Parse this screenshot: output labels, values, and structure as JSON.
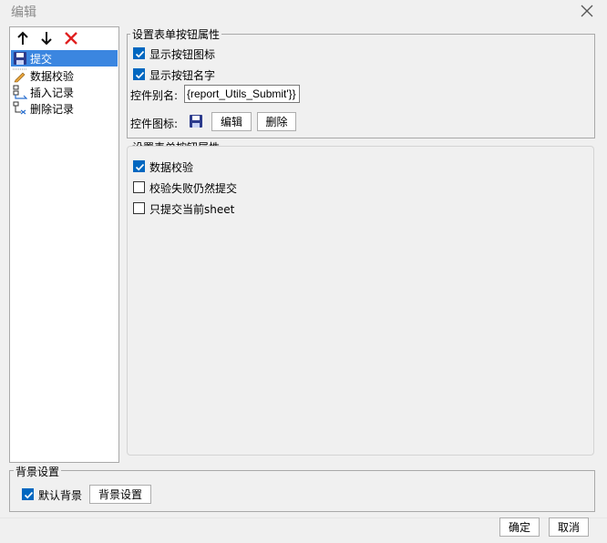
{
  "window": {
    "title": "编辑"
  },
  "toolbar": {
    "move_up_icon": "arrow-up-icon",
    "move_down_icon": "arrow-down-icon",
    "delete_icon": "red-x-icon"
  },
  "tree": {
    "items": [
      {
        "label": "提交",
        "icon": "floppy-disk-icon",
        "selected": true
      },
      {
        "label": "数据校验",
        "icon": "pencil-check-icon",
        "selected": false
      },
      {
        "label": "插入记录",
        "icon": "insert-row-icon",
        "selected": false
      },
      {
        "label": "删除记录",
        "icon": "delete-row-icon",
        "selected": false
      }
    ]
  },
  "button_props": {
    "title": "设置表单按钮属性",
    "show_icon": {
      "label": "显示按钮图标",
      "checked": true
    },
    "show_name": {
      "label": "显示按钮名字",
      "checked": true
    },
    "alias_label": "控件别名:",
    "alias_value": "{report_Utils_Submit'}}",
    "icon_label": "控件图标:",
    "icon_preview": "floppy-disk-icon",
    "edit_button": "编辑",
    "delete_button": "删除"
  },
  "form_props": {
    "title": "设置表单按钮属性",
    "data_validation": {
      "label": "数据校验",
      "checked": true
    },
    "submit_on_fail": {
      "label": "校验失败仍然提交",
      "checked": false
    },
    "submit_current_sheet": {
      "label": "只提交当前sheet",
      "checked": false
    }
  },
  "background": {
    "title": "背景设置",
    "default_bg": {
      "label": "默认背景",
      "checked": true
    },
    "settings_button": "背景设置"
  },
  "footer": {
    "ok": "确定",
    "cancel": "取消"
  },
  "colors": {
    "accent": "#0067c0",
    "selection": "#3b86e0",
    "delete_red": "#e02020"
  }
}
